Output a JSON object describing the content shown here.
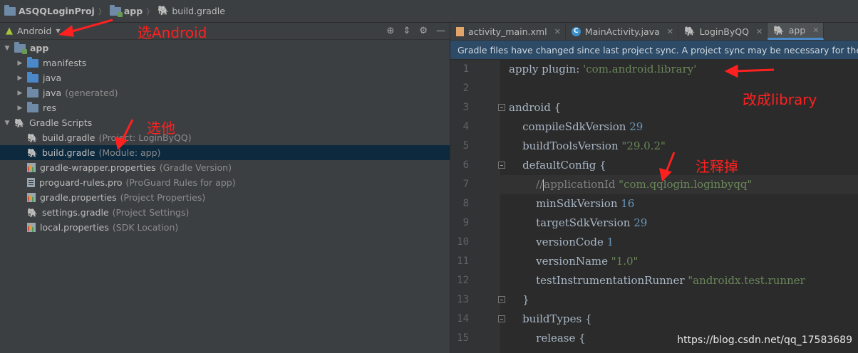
{
  "breadcrumb": {
    "project": "ASQQLoginProj",
    "module": "app",
    "file": "build.gradle"
  },
  "left_panel": {
    "view_mode": "Android",
    "tree": [
      {
        "label": "app",
        "bold": true,
        "indent": 0,
        "expanded": true,
        "icon": "module-folder-icon"
      },
      {
        "label": "manifests",
        "indent": 1,
        "expanded": false,
        "icon": "folder-icon"
      },
      {
        "label": "java",
        "indent": 1,
        "expanded": false,
        "icon": "folder-icon"
      },
      {
        "label": "java",
        "muted": "(generated)",
        "indent": 1,
        "expanded": false,
        "icon": "generated-folder-icon"
      },
      {
        "label": "res",
        "indent": 1,
        "expanded": false,
        "icon": "res-folder-icon"
      },
      {
        "label": "Gradle Scripts",
        "indent": 0,
        "expanded": true,
        "icon": "gradle-icon"
      },
      {
        "label": "build.gradle",
        "muted": "(Project: LoginByQQ)",
        "indent": 1,
        "icon": "gradle-icon"
      },
      {
        "label": "build.gradle",
        "muted": "(Module: app)",
        "indent": 1,
        "icon": "gradle-icon",
        "selected": true
      },
      {
        "label": "gradle-wrapper.properties",
        "muted": "(Gradle Version)",
        "indent": 1,
        "icon": "properties-icon"
      },
      {
        "label": "proguard-rules.pro",
        "muted": "(ProGuard Rules for app)",
        "indent": 1,
        "icon": "file-icon"
      },
      {
        "label": "gradle.properties",
        "muted": "(Project Properties)",
        "indent": 1,
        "icon": "properties-icon"
      },
      {
        "label": "settings.gradle",
        "muted": "(Project Settings)",
        "indent": 1,
        "icon": "gradle-icon"
      },
      {
        "label": "local.properties",
        "muted": "(SDK Location)",
        "indent": 1,
        "icon": "properties-icon"
      }
    ]
  },
  "tabs": [
    {
      "label": "activity_main.xml",
      "icon": "xml-file-icon",
      "active": false
    },
    {
      "label": "MainActivity.java",
      "icon": "java-class-icon",
      "active": false
    },
    {
      "label": "LoginByQQ",
      "icon": "gradle-icon",
      "active": false
    },
    {
      "label": "app",
      "icon": "gradle-icon",
      "active": true
    }
  ],
  "banner": "Gradle files have changed since last project sync. A project sync may be necessary for the IDE to",
  "code_lines": [
    {
      "no": "1",
      "parts": [
        [
          "p",
          "apply plugin: "
        ],
        [
          "s",
          "'com.android.library'"
        ]
      ]
    },
    {
      "no": "2",
      "parts": []
    },
    {
      "no": "3",
      "parts": [
        [
          "p",
          "android {"
        ]
      ]
    },
    {
      "no": "4",
      "parts": [
        [
          "p",
          "    compileSdkVersion "
        ],
        [
          "n",
          "29"
        ]
      ]
    },
    {
      "no": "5",
      "parts": [
        [
          "p",
          "    buildToolsVersion "
        ],
        [
          "s",
          "\"29.0.2\""
        ]
      ]
    },
    {
      "no": "6",
      "parts": [
        [
          "p",
          "    defaultConfig {"
        ]
      ]
    },
    {
      "no": "7",
      "parts": [
        [
          "cm",
          "        //"
        ],
        [
          "caret",
          ""
        ],
        [
          "cm",
          "applicationId "
        ],
        [
          "s",
          "\"com.qqlogin.loginbyqq\""
        ]
      ]
    },
    {
      "no": "8",
      "parts": [
        [
          "p",
          "        minSdkVersion "
        ],
        [
          "n",
          "16"
        ]
      ]
    },
    {
      "no": "9",
      "parts": [
        [
          "p",
          "        targetSdkVersion "
        ],
        [
          "n",
          "29"
        ]
      ]
    },
    {
      "no": "10",
      "parts": [
        [
          "p",
          "        versionCode "
        ],
        [
          "n",
          "1"
        ]
      ]
    },
    {
      "no": "11",
      "parts": [
        [
          "p",
          "        versionName "
        ],
        [
          "s",
          "\"1.0\""
        ]
      ]
    },
    {
      "no": "12",
      "parts": [
        [
          "p",
          "        testInstrumentationRunner "
        ],
        [
          "s",
          "\"androidx.test.runner"
        ]
      ]
    },
    {
      "no": "13",
      "parts": [
        [
          "p",
          "    }"
        ]
      ]
    },
    {
      "no": "14",
      "parts": [
        [
          "p",
          "    buildTypes {"
        ]
      ]
    },
    {
      "no": "15",
      "parts": [
        [
          "p",
          "        release {"
        ]
      ]
    }
  ],
  "annotations": {
    "select_android": "选Android",
    "select_it": "选他",
    "change_library": "改成library",
    "comment_out": "注释掉"
  },
  "watermark": "https://blog.csdn.net/qq_17583689",
  "colors": {
    "annotation": "#ff2020",
    "string": "#6a8759",
    "number": "#6897bb",
    "selected_row": "#0d293e",
    "banner": "#2d4a66"
  }
}
